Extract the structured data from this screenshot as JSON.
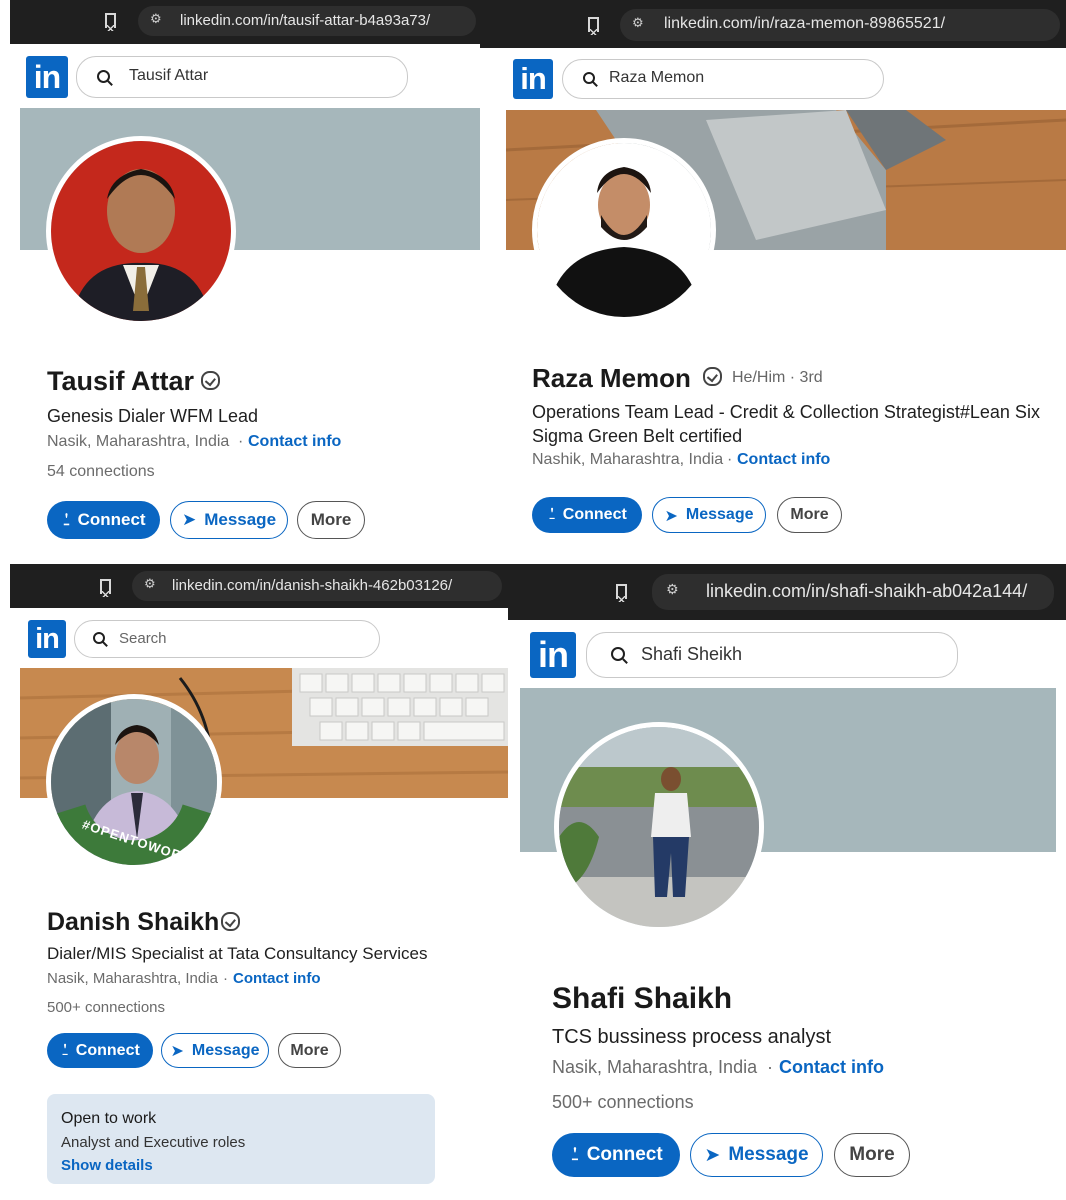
{
  "colors": {
    "linkedin_blue": "#0a66c2",
    "browser_bar": "#1f1f1f",
    "banner_gray": "#a6b7bb"
  },
  "logo_text": "in",
  "panels": [
    {
      "url": "linkedin.com/in/tausif-attar-b4a93a73/",
      "search": "Tausif Attar",
      "name": "Tausif Attar",
      "headline": "Genesis Dialer WFM Lead",
      "location": "Nasik, Maharashtra, India",
      "contact": "Contact info",
      "connections": "54 connections",
      "connect": "Connect",
      "message": "Message",
      "more": "More"
    },
    {
      "url": "linkedin.com/in/raza-memon-89865521/",
      "search": "Raza Memon",
      "name": "Raza Memon",
      "pronouns": "He/Him · 3rd",
      "headline": "Operations Team Lead - Credit & Collection Strategist#Lean Six Sigma Green Belt certified",
      "location": "Nashik, Maharashtra, India",
      "contact": "Contact info",
      "connect": "Connect",
      "message": "Message",
      "more": "More"
    },
    {
      "url": "linkedin.com/in/danish-shaikh-462b03126/",
      "search": "Search",
      "name": "Danish Shaikh",
      "headline": "Dialer/MIS Specialist at Tata Consultancy Services",
      "location": "Nasik, Maharashtra, India",
      "contact": "Contact info",
      "connections": "500+ connections",
      "connect": "Connect",
      "message": "Message",
      "more": "More",
      "open_to_work_ring": "#OPENTOWORK",
      "open_to_work": {
        "title": "Open to work",
        "roles": "Analyst and Executive roles",
        "link": "Show details"
      }
    },
    {
      "url": "linkedin.com/in/shafi-shaikh-ab042a144/",
      "search": "Shafi Sheikh",
      "name": "Shafi Shaikh",
      "headline": "TCS bussiness process analyst",
      "location": "Nasik, Maharashtra, India",
      "contact": "Contact info",
      "connections": "500+ connections",
      "connect": "Connect",
      "message": "Message",
      "more": "More"
    }
  ]
}
